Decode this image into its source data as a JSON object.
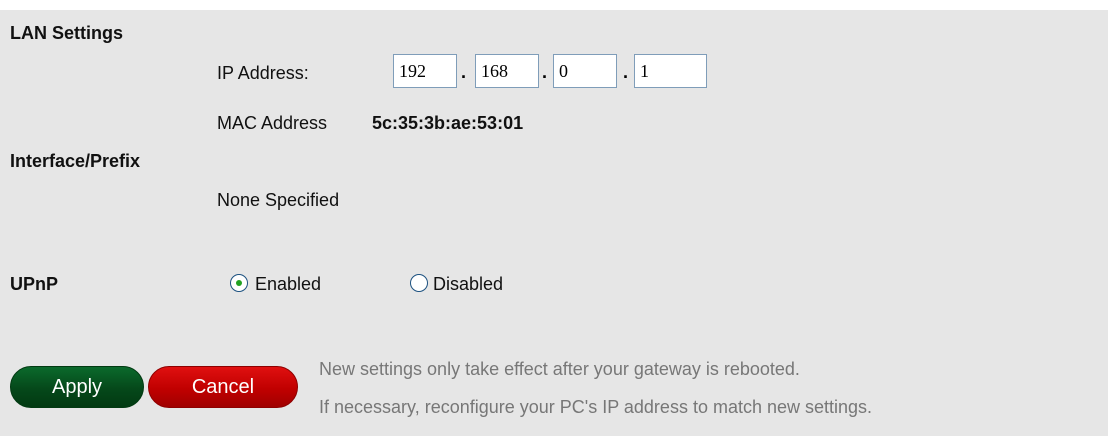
{
  "lan_settings": {
    "title": "LAN Settings",
    "ip_label": "IP Address:",
    "ip_octets": [
      "192",
      "168",
      "0",
      "1"
    ],
    "ip_separator": ".",
    "mac_label": "MAC Address",
    "mac_value": "5c:35:3b:ae:53:01"
  },
  "interface_prefix": {
    "title": "Interface/Prefix",
    "value": "None Specified"
  },
  "upnp": {
    "title": "UPnP",
    "options": [
      {
        "label": "Enabled",
        "selected": true
      },
      {
        "label": "Disabled",
        "selected": false
      }
    ]
  },
  "actions": {
    "apply_label": "Apply",
    "cancel_label": "Cancel"
  },
  "notes": {
    "line1": "New settings only take effect after your gateway is rebooted.",
    "line2": "If necessary, reconfigure your PC's IP address to match new settings."
  },
  "colors": {
    "panel_bg": "#e6e6e6",
    "apply_green": "#05481a",
    "cancel_red": "#c00000",
    "radio_dot": "#21a121",
    "note_text": "#777777"
  }
}
